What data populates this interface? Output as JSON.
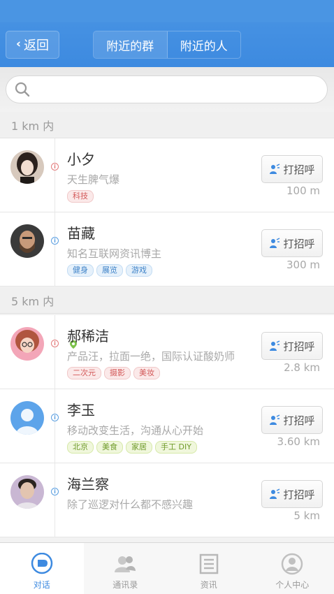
{
  "header": {
    "back_label": "返回",
    "segments": [
      {
        "label": "附近的群",
        "active": false
      },
      {
        "label": "附近的人",
        "active": true
      }
    ]
  },
  "search": {
    "placeholder": "",
    "value": ""
  },
  "sections": [
    {
      "title": "1 km 内"
    },
    {
      "title": "5 km 内"
    }
  ],
  "people": [
    {
      "name": "小夕",
      "bio": "天生脾气爆",
      "gender": "female",
      "tags": [
        {
          "text": "科技",
          "color": "red"
        }
      ],
      "distance": "100 m",
      "greet_label": "打招呼"
    },
    {
      "name": "苗藏",
      "bio": "知名互联网资讯博主",
      "gender": "male",
      "tags": [
        {
          "text": "健身",
          "color": "blue"
        },
        {
          "text": "展览",
          "color": "blue"
        },
        {
          "text": "游戏",
          "color": "blue"
        }
      ],
      "distance": "300 m",
      "greet_label": "打招呼"
    },
    {
      "name": "郝稀洁",
      "bio": "产品汪，拉面一绝，国际认证酸奶师",
      "gender": "female",
      "tags": [
        {
          "text": "二次元",
          "color": "red"
        },
        {
          "text": "摄影",
          "color": "red"
        },
        {
          "text": "美妆",
          "color": "red"
        }
      ],
      "distance": "2.8 km",
      "greet_label": "打招呼"
    },
    {
      "name": "李玉",
      "bio": "移动改变生活，沟通从心开始",
      "gender": "male",
      "tags": [
        {
          "text": "北京",
          "color": "green"
        },
        {
          "text": "美食",
          "color": "green"
        },
        {
          "text": "家居",
          "color": "green"
        },
        {
          "text": "手工 DIY",
          "color": "green"
        }
      ],
      "distance": "3.60 km",
      "greet_label": "打招呼"
    },
    {
      "name": "海兰察",
      "bio": "除了巡逻对什么都不感兴趣",
      "gender": "male",
      "tags": [],
      "distance": "5 km",
      "greet_label": "打招呼"
    }
  ],
  "tabbar": [
    {
      "label": "对话",
      "icon": "chat-bubble-icon",
      "active": true
    },
    {
      "label": "通讯录",
      "icon": "contacts-icon",
      "active": false
    },
    {
      "label": "资讯",
      "icon": "news-icon",
      "active": false
    },
    {
      "label": "个人中心",
      "icon": "profile-icon",
      "active": false
    }
  ],
  "colors": {
    "primary": "#3d8ae0",
    "female": "#e37b7b",
    "male": "#5a9ee0"
  }
}
